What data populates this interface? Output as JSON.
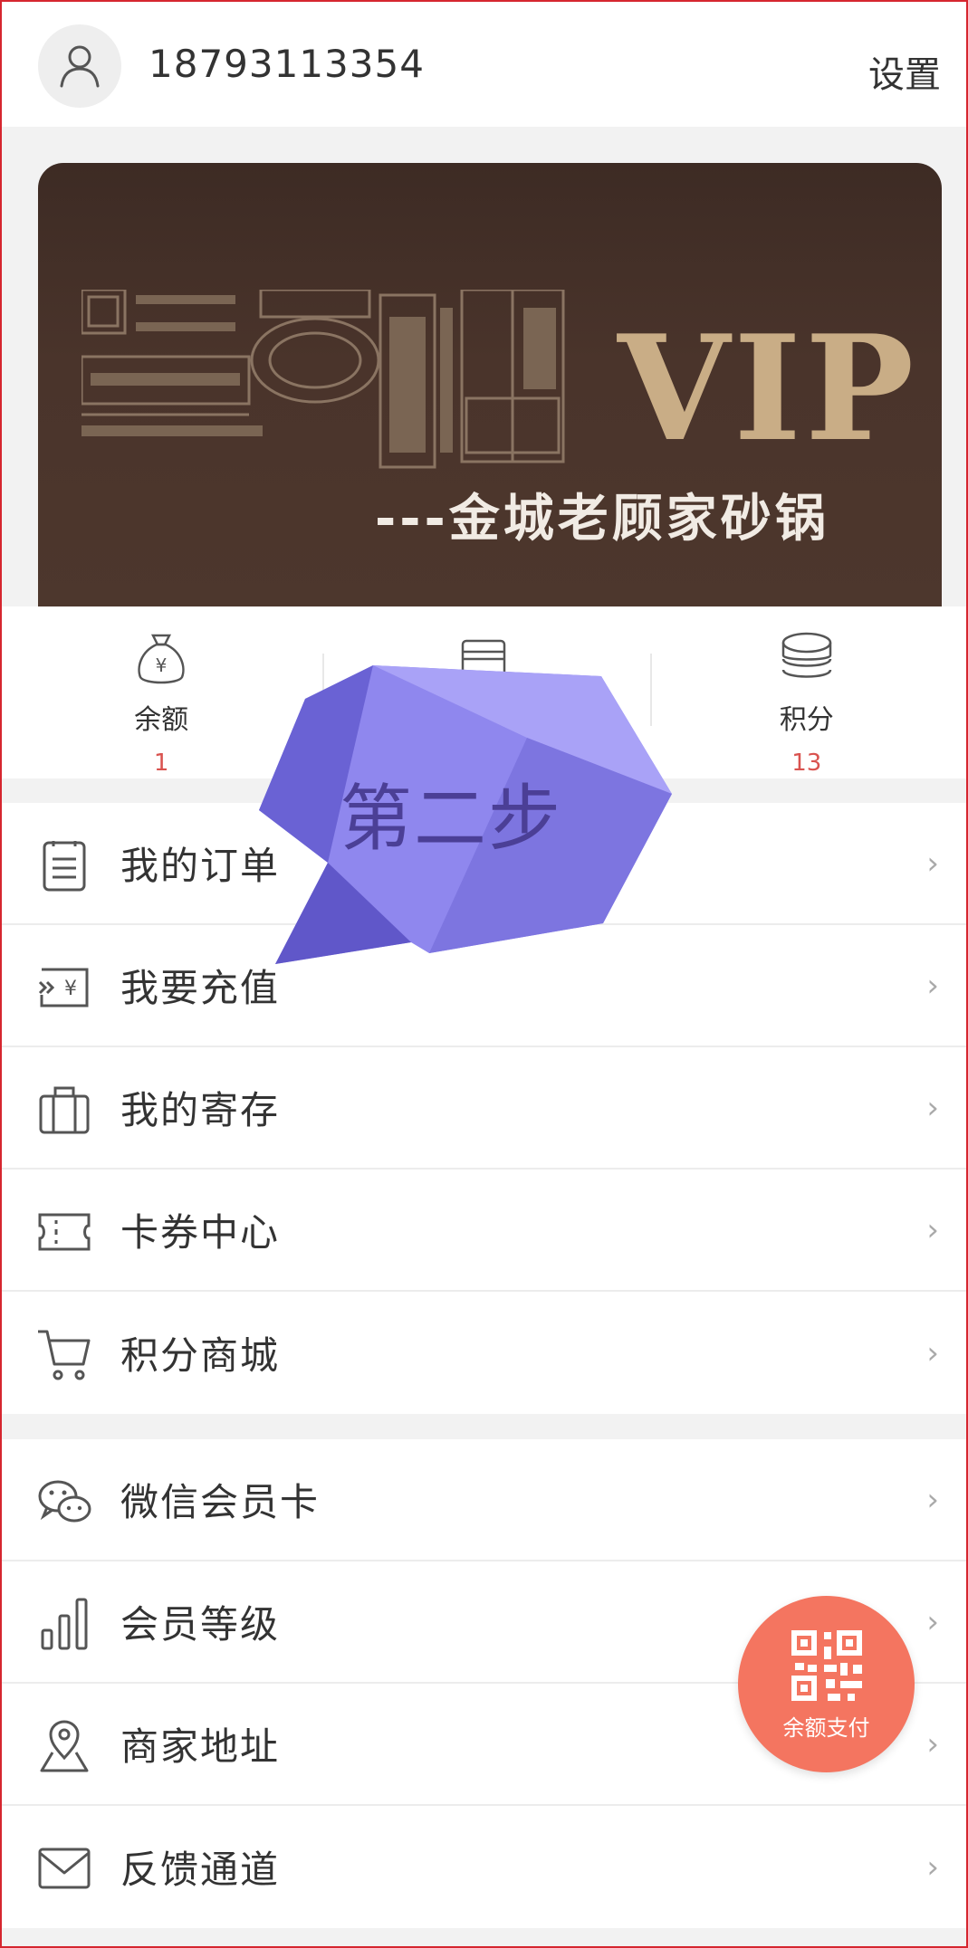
{
  "header": {
    "phone": "18793113354",
    "settings_label": "设置"
  },
  "banner": {
    "vip_text": "VIP",
    "brand_text": "---金城老顾家砂锅"
  },
  "stats": [
    {
      "label": "余额",
      "value": "1",
      "icon": "money-bag-icon"
    },
    {
      "label": "",
      "value": "",
      "icon": "card-icon"
    },
    {
      "label": "积分",
      "value": "13",
      "icon": "coins-icon"
    }
  ],
  "menu_group1": [
    {
      "label": "我的订单",
      "icon": "order-list-icon"
    },
    {
      "label": "我要充值",
      "icon": "recharge-icon"
    },
    {
      "label": "我的寄存",
      "icon": "storage-icon"
    },
    {
      "label": "卡券中心",
      "icon": "coupon-icon"
    },
    {
      "label": "积分商城",
      "icon": "cart-icon"
    }
  ],
  "menu_group2": [
    {
      "label": "微信会员卡",
      "icon": "wechat-icon"
    },
    {
      "label": "会员等级",
      "icon": "level-bars-icon"
    },
    {
      "label": "商家地址",
      "icon": "location-icon"
    },
    {
      "label": "反馈通道",
      "icon": "mail-icon"
    }
  ],
  "overlay": {
    "step_text": "第二步"
  },
  "pay_button": {
    "label": "余额支付",
    "icon": "qr-code-icon"
  },
  "colors": {
    "accent_red": "#d9534f",
    "pay_button": "#f47560",
    "banner_gold": "#c9ad86",
    "bubble_purple": "#9b93f2"
  }
}
